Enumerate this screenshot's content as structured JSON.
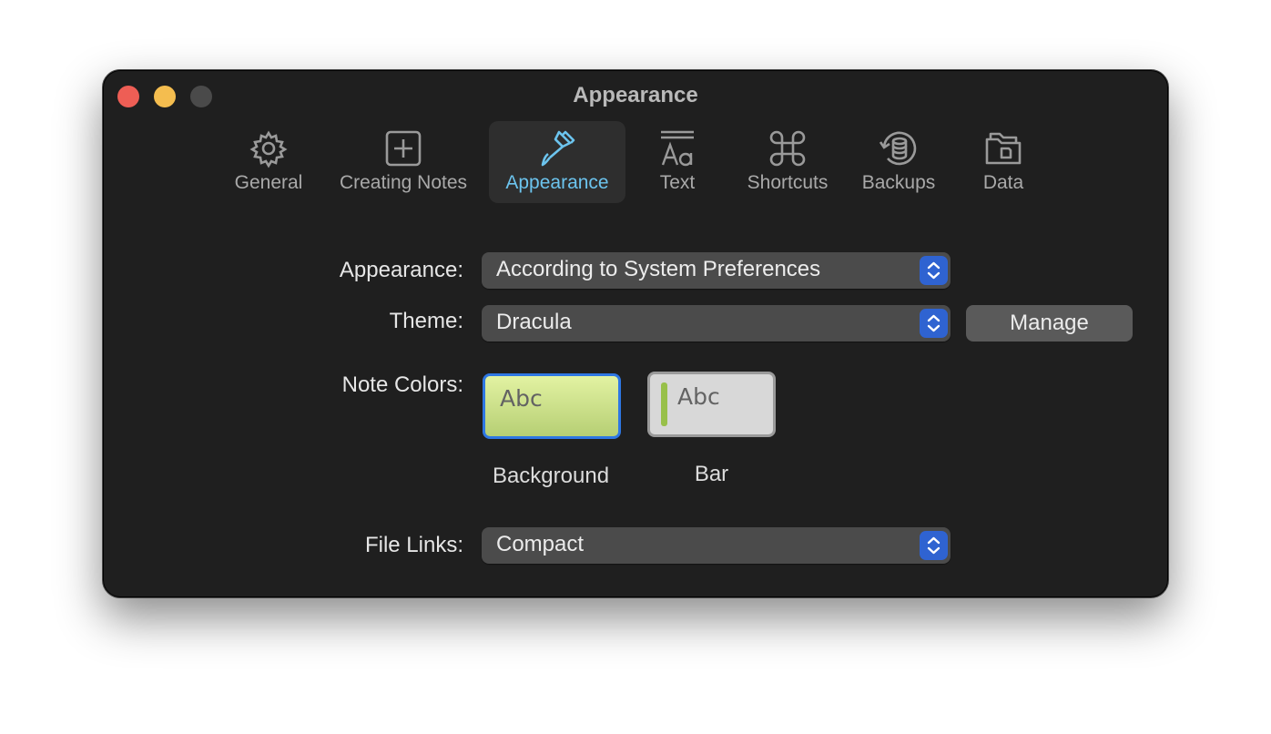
{
  "window": {
    "title": "Appearance"
  },
  "toolbar": {
    "tabs": [
      {
        "label": "General",
        "icon": "gear-icon"
      },
      {
        "label": "Creating Notes",
        "icon": "plus-square-icon"
      },
      {
        "label": "Appearance",
        "icon": "paintbrush-icon",
        "active": true
      },
      {
        "label": "Text",
        "icon": "text-format-icon"
      },
      {
        "label": "Shortcuts",
        "icon": "command-icon"
      },
      {
        "label": "Backups",
        "icon": "backup-database-icon"
      },
      {
        "label": "Data",
        "icon": "folder-icon"
      }
    ]
  },
  "settings": {
    "appearance": {
      "label": "Appearance:",
      "value": "According to System Preferences"
    },
    "theme": {
      "label": "Theme:",
      "value": "Dracula",
      "manage_label": "Manage"
    },
    "note_colors": {
      "label": "Note Colors:",
      "options": [
        {
          "sample": "Abc",
          "caption": "Background",
          "selected": true
        },
        {
          "sample": "Abc",
          "caption": "Bar",
          "selected": false
        }
      ]
    },
    "file_links": {
      "label": "File Links:",
      "value": "Compact"
    }
  },
  "colors": {
    "window_bg": "#1f1f1f",
    "accent": "#2f63d1",
    "active_tab_text": "#6cc4ee",
    "close": "#ee5e55",
    "minimize": "#f4bd4f",
    "bar_accent": "#98c04a"
  }
}
